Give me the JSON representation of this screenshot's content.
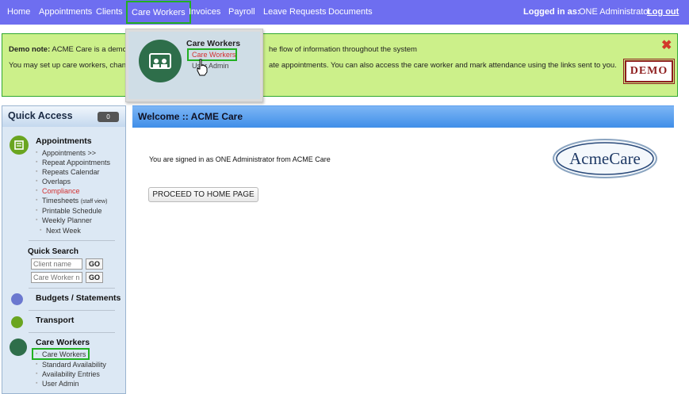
{
  "topnav": {
    "items": [
      "Home",
      "Appointments",
      "Clients",
      "Care Workers",
      "Invoices",
      "Payroll",
      "Leave Requests",
      "Documents"
    ],
    "logged_in_label": "Logged in as:",
    "user": "ONE Administrator",
    "logout": "Log out"
  },
  "demo": {
    "note_label": "Demo note:",
    "line1_left": "ACME Care is a demo c",
    "line1_right": "he flow of information throughout the system",
    "line2_left": "You may set up care workers, chang",
    "line2_right": "ate appointments. You can also access the care worker and mark attendance using the links sent to you.",
    "badge": "DEMO"
  },
  "dropdown": {
    "title": "Care Workers",
    "links": [
      "Care Workers",
      "User Admin"
    ]
  },
  "sidebar": {
    "title": "Quick Access",
    "badge": "0",
    "appointments": {
      "title": "Appointments",
      "items": [
        "Appointments >>",
        "Repeat Appointments",
        "Repeats Calendar",
        "Overlaps",
        "Compliance",
        "Timesheets",
        "Printable Schedule",
        "Weekly Planner",
        "Next Week"
      ],
      "timesheets_note": "(staff view)"
    },
    "quick_search": {
      "title": "Quick Search",
      "client_placeholder": "Client name",
      "worker_placeholder": "Care Worker n",
      "go": "GO"
    },
    "budgets": "Budgets / Statements",
    "transport": "Transport",
    "care_workers": {
      "title": "Care Workers",
      "items": [
        "Care Workers",
        "Standard Availability",
        "Availability Entries",
        "User Admin"
      ]
    }
  },
  "main": {
    "title": "Welcome :: ACME Care",
    "signed_in": "You are signed in as ONE Administrator from ACME Care",
    "proceed": "PROCEED TO HOME PAGE",
    "logo_text": "AcmeCare"
  },
  "colors": {
    "nav_bg": "#6e6ef0",
    "demo_bg": "#ccf08a",
    "highlight": "#22b022",
    "header_blue": "#3f8ee8"
  }
}
